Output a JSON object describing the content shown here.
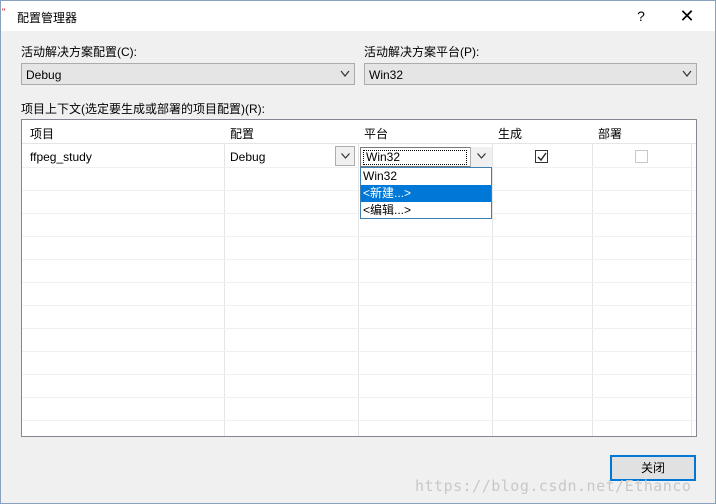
{
  "window": {
    "title": "配置管理器",
    "help_glyph": "?",
    "close_glyph": "✕",
    "corner_mark": "\""
  },
  "active_config": {
    "label": "活动解决方案配置(C):",
    "value": "Debug"
  },
  "active_platform": {
    "label": "活动解决方案平台(P):",
    "value": "Win32"
  },
  "grid": {
    "label": "项目上下文(选定要生成或部署的项目配置)(R):",
    "columns": [
      "项目",
      "配置",
      "平台",
      "生成",
      "部署"
    ],
    "rows": [
      {
        "project": "ffpeg_study",
        "config": "Debug",
        "platform": "Win32",
        "build": true,
        "deploy": false,
        "deploy_enabled": false
      }
    ]
  },
  "platform_dropdown": {
    "options": [
      "Win32",
      "<新建...>",
      "<编辑...>"
    ],
    "highlighted": "<新建...>"
  },
  "footer": {
    "close_label": "关闭"
  },
  "watermark": "https://blog.csdn.net/Ethanco",
  "colors": {
    "selection": "#0078d7",
    "dialog_bg": "#f0f0f0",
    "grid_border": "#828790"
  },
  "icons": {
    "dropdown": "chevron-down-icon",
    "check": "checkmark-icon",
    "help": "help-icon",
    "close": "close-icon"
  }
}
